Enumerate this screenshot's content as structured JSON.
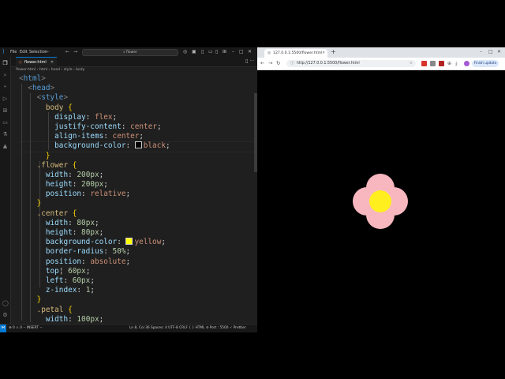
{
  "vscode": {
    "menu": [
      "File",
      "Edit",
      "Selection"
    ],
    "search": "flower",
    "tab_label": "flower.html",
    "breadcrumbs": [
      "flower.html",
      "html",
      "head",
      "style",
      "body"
    ],
    "status": {
      "left": "⊗ 0 ⚠ 0    -- INSERT --",
      "right": "Ln 8, Col 36   Spaces: 4   UTF-8   CRLF   { } HTML   ⊘ Port : 5500   ✓ Prettier"
    },
    "colors": {
      "accent": "#0078d4",
      "black_swatch": "#000000",
      "yellow_swatch": "#ffff00"
    }
  },
  "code_lines": [
    [
      {
        "c": "t-br",
        "t": "<"
      },
      {
        "c": "t-tag",
        "t": "html"
      },
      {
        "c": "t-br",
        "t": ">"
      }
    ],
    [
      {
        "c": "t-p",
        "t": "  "
      },
      {
        "c": "t-br",
        "t": "<"
      },
      {
        "c": "t-tag",
        "t": "head"
      },
      {
        "c": "t-br",
        "t": ">"
      }
    ],
    [
      {
        "c": "t-p",
        "t": "    "
      },
      {
        "c": "t-br",
        "t": "<"
      },
      {
        "c": "t-tag",
        "t": "style"
      },
      {
        "c": "t-br",
        "t": ">"
      }
    ],
    [
      {
        "c": "t-p",
        "t": "      "
      },
      {
        "c": "t-sel",
        "t": "body"
      },
      {
        "c": "t-p",
        "t": " "
      },
      {
        "c": "t-brace",
        "t": "{"
      }
    ],
    [
      {
        "c": "t-p",
        "t": "        "
      },
      {
        "c": "t-prop",
        "t": "display"
      },
      {
        "c": "t-p",
        "t": ": "
      },
      {
        "c": "t-val",
        "t": "flex"
      },
      {
        "c": "t-p",
        "t": ";"
      }
    ],
    [
      {
        "c": "t-p",
        "t": "        "
      },
      {
        "c": "t-prop",
        "t": "justify-content"
      },
      {
        "c": "t-p",
        "t": ": "
      },
      {
        "c": "t-val",
        "t": "center"
      },
      {
        "c": "t-p",
        "t": ";"
      }
    ],
    [
      {
        "c": "t-p",
        "t": "        "
      },
      {
        "c": "t-prop",
        "t": "align-items"
      },
      {
        "c": "t-p",
        "t": ": "
      },
      {
        "c": "t-val",
        "t": "center"
      },
      {
        "c": "t-p",
        "t": ";"
      }
    ],
    [
      {
        "c": "t-p",
        "t": "        "
      },
      {
        "c": "t-prop",
        "t": "background-color"
      },
      {
        "c": "t-p",
        "t": ": "
      },
      {
        "c": "swatch",
        "t": "#000000"
      },
      {
        "c": "t-val",
        "t": "black"
      },
      {
        "c": "t-p",
        "t": ";"
      }
    ],
    [
      {
        "c": "t-p",
        "t": "      "
      },
      {
        "c": "t-brace",
        "t": "}"
      }
    ],
    [
      {
        "c": "t-p",
        "t": "    "
      },
      {
        "c": "t-dot",
        "t": ".flower"
      },
      {
        "c": "t-p",
        "t": " "
      },
      {
        "c": "t-brace",
        "t": "{"
      }
    ],
    [
      {
        "c": "t-p",
        "t": "      "
      },
      {
        "c": "t-prop",
        "t": "width"
      },
      {
        "c": "t-p",
        "t": ": "
      },
      {
        "c": "t-num",
        "t": "200px"
      },
      {
        "c": "t-p",
        "t": ";"
      }
    ],
    [
      {
        "c": "t-p",
        "t": "      "
      },
      {
        "c": "t-prop",
        "t": "height"
      },
      {
        "c": "t-p",
        "t": ": "
      },
      {
        "c": "t-num",
        "t": "200px"
      },
      {
        "c": "t-p",
        "t": ";"
      }
    ],
    [
      {
        "c": "t-p",
        "t": "      "
      },
      {
        "c": "t-prop",
        "t": "position"
      },
      {
        "c": "t-p",
        "t": ": "
      },
      {
        "c": "t-val",
        "t": "relative"
      },
      {
        "c": "t-p",
        "t": ";"
      }
    ],
    [
      {
        "c": "t-p",
        "t": "    "
      },
      {
        "c": "t-brace",
        "t": "}"
      }
    ],
    [
      {
        "c": "t-p",
        "t": "    "
      },
      {
        "c": "t-dot",
        "t": ".center"
      },
      {
        "c": "t-p",
        "t": " "
      },
      {
        "c": "t-brace",
        "t": "{"
      }
    ],
    [
      {
        "c": "t-p",
        "t": "      "
      },
      {
        "c": "t-prop",
        "t": "width"
      },
      {
        "c": "t-p",
        "t": ": "
      },
      {
        "c": "t-num",
        "t": "80px"
      },
      {
        "c": "t-p",
        "t": ";"
      }
    ],
    [
      {
        "c": "t-p",
        "t": "      "
      },
      {
        "c": "t-prop",
        "t": "height"
      },
      {
        "c": "t-p",
        "t": ": "
      },
      {
        "c": "t-num",
        "t": "80px"
      },
      {
        "c": "t-p",
        "t": ";"
      }
    ],
    [
      {
        "c": "t-p",
        "t": "      "
      },
      {
        "c": "t-prop",
        "t": "background-color"
      },
      {
        "c": "t-p",
        "t": ": "
      },
      {
        "c": "swatch",
        "t": "#ffff00"
      },
      {
        "c": "t-val",
        "t": "yellow"
      },
      {
        "c": "t-p",
        "t": ";"
      }
    ],
    [
      {
        "c": "t-p",
        "t": "      "
      },
      {
        "c": "t-prop",
        "t": "border-radius"
      },
      {
        "c": "t-p",
        "t": ": "
      },
      {
        "c": "t-num",
        "t": "50%"
      },
      {
        "c": "t-p",
        "t": ";"
      }
    ],
    [
      {
        "c": "t-p",
        "t": "      "
      },
      {
        "c": "t-prop",
        "t": "position"
      },
      {
        "c": "t-p",
        "t": ": "
      },
      {
        "c": "t-val",
        "t": "absolute"
      },
      {
        "c": "t-p",
        "t": ";"
      }
    ],
    [
      {
        "c": "t-p",
        "t": "      "
      },
      {
        "c": "t-prop",
        "t": "top"
      },
      {
        "c": "t-p",
        "t": "¦ "
      },
      {
        "c": "t-num",
        "t": "60px"
      },
      {
        "c": "t-p",
        "t": ";"
      }
    ],
    [
      {
        "c": "t-p",
        "t": "      "
      },
      {
        "c": "t-prop",
        "t": "left"
      },
      {
        "c": "t-p",
        "t": ": "
      },
      {
        "c": "t-num",
        "t": "60px"
      },
      {
        "c": "t-p",
        "t": ";"
      }
    ],
    [
      {
        "c": "t-p",
        "t": "      "
      },
      {
        "c": "t-prop",
        "t": "z-index"
      },
      {
        "c": "t-p",
        "t": ": "
      },
      {
        "c": "t-num",
        "t": "1"
      },
      {
        "c": "t-p",
        "t": ";"
      }
    ],
    [
      {
        "c": "t-p",
        "t": "    "
      },
      {
        "c": "t-brace",
        "t": "}"
      }
    ],
    [
      {
        "c": "t-p",
        "t": "    "
      },
      {
        "c": "t-dot",
        "t": ".petal"
      },
      {
        "c": "t-p",
        "t": " "
      },
      {
        "c": "t-brace",
        "t": "{"
      }
    ],
    [
      {
        "c": "t-p",
        "t": "      "
      },
      {
        "c": "t-prop",
        "t": "width"
      },
      {
        "c": "t-p",
        "t": ": "
      },
      {
        "c": "t-num",
        "t": "100px"
      },
      {
        "c": "t-p",
        "t": ";"
      }
    ]
  ],
  "browser": {
    "tab_title": "127.0.0.1:5500/flower.html",
    "url": "http://127.0.0.1:5500/flower.html",
    "finish_update": "Finish update",
    "colors": {
      "petal": "#f8b7bf",
      "center": "#ffef1f",
      "background": "#000000"
    }
  }
}
